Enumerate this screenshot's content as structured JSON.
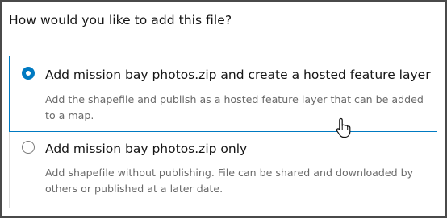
{
  "dialog": {
    "question": "How would you like to add this file?"
  },
  "options": [
    {
      "title": "Add mission bay photos.zip and create a hosted feature layer",
      "description": "Add the shapefile and publish as a hosted feature layer that can be added to a map.",
      "selected": true
    },
    {
      "title": "Add mission bay photos.zip only",
      "description": "Add shapefile without publishing. File can be shared and downloaded by others or published at a later date.",
      "selected": false
    }
  ],
  "colors": {
    "accent": "#007ac2",
    "text": "#151515",
    "muted_text": "#6a6a6a",
    "border": "#dcdcdc"
  },
  "cursor": {
    "icon": "hand-pointer-icon"
  }
}
